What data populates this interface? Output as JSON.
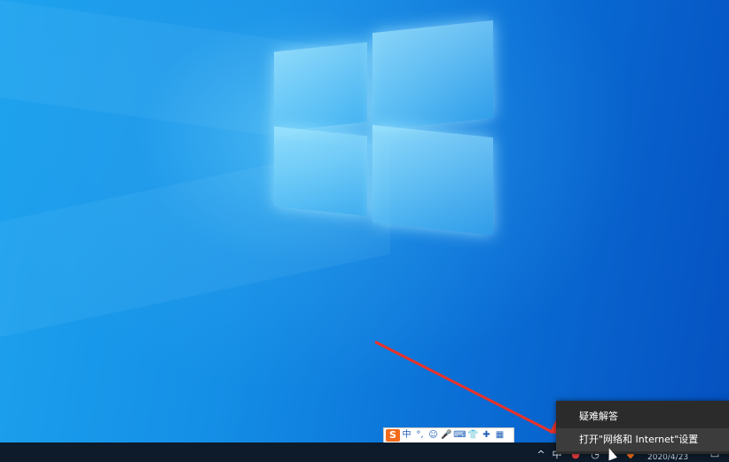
{
  "ime_toolbar": {
    "logo": "S",
    "items": [
      "中",
      "°,",
      "☺",
      "🎤",
      "⌨",
      "👕",
      "✚",
      "▦"
    ]
  },
  "context_menu": {
    "items": [
      {
        "label": "疑难解答"
      },
      {
        "label": "打开\"网络和 Internet\"设置"
      }
    ]
  },
  "taskbar": {
    "clock_text": "2020/4/23"
  },
  "colors": {
    "annotation_arrow": "#e8322a",
    "menu_bg": "#2b2b2b",
    "taskbar_bg": "#0d1b2a"
  }
}
